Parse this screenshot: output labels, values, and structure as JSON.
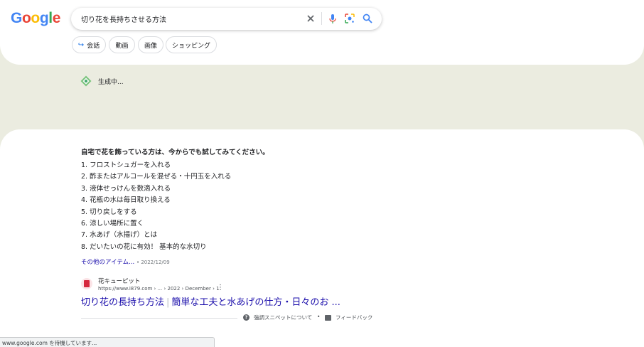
{
  "header": {
    "logo": {
      "letters": [
        "G",
        "o",
        "o",
        "g",
        "l",
        "e"
      ],
      "colors": [
        "#4285F4",
        "#EA4335",
        "#FBBC05",
        "#4285F4",
        "#34A853",
        "#EA4335"
      ]
    },
    "search": {
      "query": "切り花を長持ちさせる方法",
      "icons": [
        "close-icon",
        "mic-icon",
        "lens-icon",
        "search-icon"
      ]
    },
    "chips": [
      {
        "label": "会話",
        "icon": "arrow-icon"
      },
      {
        "label": "動画"
      },
      {
        "label": "画像"
      },
      {
        "label": "ショッピング"
      }
    ]
  },
  "ai": {
    "status": "生成中..."
  },
  "snippet": {
    "heading": "自宅で花を飾っている方は、今からでも試してみてください。",
    "items": [
      "1. フロストシュガーを入れる",
      "2. 酢またはアルコールを混ぜる・十円玉を入れる",
      "3. 液体せっけんを数滴入れる",
      "4. 花瓶の水は毎日取り換える",
      "5. 切り戻しをする",
      "6. 涼しい場所に置く",
      "7. 水あげ（水揚げ）とは",
      "8. だいたいの花に有効！ 基本的な水切り"
    ],
    "more_link": "その他のアイテム...",
    "date": "• 2022/12/09",
    "source": {
      "name": "花キューピット",
      "url": "https://www.i879.com › ... › 2022 › December › 1",
      "menu": "⋮"
    },
    "title_main": "切り花の長持ち方法",
    "title_sep": "|",
    "title_rest": "簡単な工夫と水あげの仕方・日々のお ..."
  },
  "feedback": {
    "about": "強調スニペットについて",
    "dot": "•",
    "feedback": "フィードバック"
  },
  "status_bar": {
    "text": "www.google.com を待機しています..."
  },
  "colors": {
    "link": "#1a0dab",
    "background_band": "#ebece0",
    "accent": "#1a73e8"
  }
}
